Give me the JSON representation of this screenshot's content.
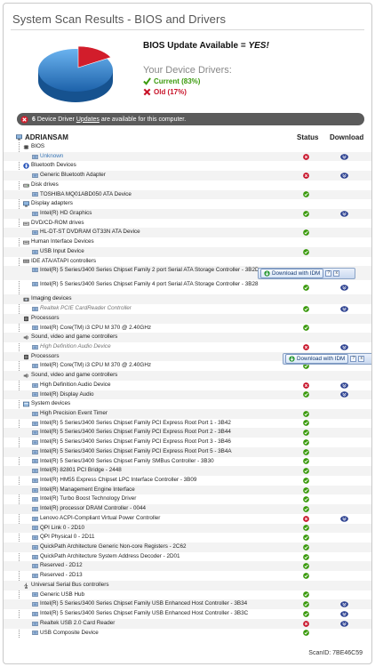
{
  "title": "System Scan Results - BIOS and Drivers",
  "summary": {
    "bios_prefix": "BIOS Update Available = ",
    "bios_value": "YES!",
    "drivers_title": "Your Device Drivers:",
    "current_label": "Current (83%)",
    "old_label": "Old (17%)",
    "current_fraction": 0.83,
    "old_fraction": 0.17
  },
  "banner": {
    "count": "6",
    "pre": "Device Driver",
    "link": "Updates",
    "post": "are available for this computer."
  },
  "table": {
    "root": "ADRIANSAM",
    "status_header": "Status",
    "download_header": "Download"
  },
  "rows": [
    {
      "kind": "cat",
      "text": "BIOS",
      "icon": "chip-icon"
    },
    {
      "kind": "dev",
      "text": "Unknown",
      "blue": true,
      "status": "old",
      "download": true
    },
    {
      "kind": "cat",
      "text": "Bluetooth Devices",
      "icon": "bluetooth-icon"
    },
    {
      "kind": "dev",
      "text": "Generic Bluetooth Adapter",
      "status": "old",
      "download": true
    },
    {
      "kind": "cat",
      "text": "Disk drives",
      "icon": "disk-icon"
    },
    {
      "kind": "dev",
      "text": "TOSHIBA MQ01ABD050 ATA Device",
      "status": "current"
    },
    {
      "kind": "cat",
      "text": "Display adapters",
      "icon": "monitor-icon"
    },
    {
      "kind": "dev",
      "text": "Intel(R) HD Graphics",
      "status": "current",
      "download": true
    },
    {
      "kind": "cat",
      "text": "DVD/CD-ROM drives",
      "icon": "dvd-icon"
    },
    {
      "kind": "dev",
      "text": "HL-DT-ST DVDRAM GT33N ATA Device",
      "status": "current"
    },
    {
      "kind": "cat",
      "text": "Human Interface Devices",
      "icon": "keyboard-icon"
    },
    {
      "kind": "dev",
      "text": "USB Input Device",
      "status": "current"
    },
    {
      "kind": "cat",
      "text": "IDE ATA/ATAPI controllers",
      "icon": "controller-icon"
    },
    {
      "kind": "dev",
      "wrap": true,
      "text": "Intel(R) 5 Series/3400 Series Chipset Family 2 port Serial ATA Storage Controller - 3B2D",
      "status": "current",
      "download": true
    },
    {
      "kind": "dev",
      "wrap": true,
      "text": "Intel(R) 5 Series/3400 Series Chipset Family 4 port Serial ATA Storage Controller - 3B28",
      "status": "current",
      "download": true
    },
    {
      "kind": "cat",
      "text": "Imaging devices",
      "icon": "camera-icon"
    },
    {
      "kind": "dev",
      "text": "Realtek PCIE CardReader Controller",
      "ghost": true,
      "status": "current",
      "download": true
    },
    {
      "kind": "cat",
      "text": "Processors",
      "icon": "cpu-icon"
    },
    {
      "kind": "dev",
      "text": "Intel(R) Core(TM) i3 CPU M 370 @ 2.40GHz",
      "status": "current"
    },
    {
      "kind": "cat",
      "text": "Sound, video and game controllers",
      "icon": "speaker-icon"
    },
    {
      "kind": "dev",
      "text": "High Definition Audio Device",
      "ghost": true,
      "status": "old",
      "download": true
    },
    {
      "kind": "cat",
      "text": "Processors",
      "icon": "cpu-icon"
    },
    {
      "kind": "dev",
      "text": "Intel(R) Core(TM) i3 CPU M 370 @ 2.40GHz",
      "status": "current"
    },
    {
      "kind": "cat",
      "text": "Sound, video and game controllers",
      "icon": "speaker-icon"
    },
    {
      "kind": "dev",
      "text": "High Definition Audio Device",
      "status": "old",
      "download": true
    },
    {
      "kind": "dev",
      "text": "Intel(R) Display Audio",
      "status": "current",
      "download": true
    },
    {
      "kind": "cat",
      "text": "System devices",
      "icon": "system-icon"
    },
    {
      "kind": "dev",
      "text": "High Precision Event Timer",
      "status": "current"
    },
    {
      "kind": "dev",
      "text": "Intel(R) 5 Series/3400 Series Chipset Family PCI Express Root Port 1 - 3B42",
      "status": "current"
    },
    {
      "kind": "dev",
      "text": "Intel(R) 5 Series/3400 Series Chipset Family PCI Express Root Port 2 - 3B44",
      "status": "current"
    },
    {
      "kind": "dev",
      "text": "Intel(R) 5 Series/3400 Series Chipset Family PCI Express Root Port 3 - 3B46",
      "status": "current"
    },
    {
      "kind": "dev",
      "text": "Intel(R) 5 Series/3400 Series Chipset Family PCI Express Root Port 5 - 3B4A",
      "status": "current"
    },
    {
      "kind": "dev",
      "text": "Intel(R) 5 Series/3400 Series Chipset Family SMBus Controller - 3B30",
      "status": "current"
    },
    {
      "kind": "dev",
      "text": "Intel(R) 82801 PCI Bridge - 2448",
      "status": "current"
    },
    {
      "kind": "dev",
      "text": "Intel(R) HM55 Express Chipset LPC Interface Controller - 3B09",
      "status": "current"
    },
    {
      "kind": "dev",
      "text": "Intel(R) Management Engine Interface",
      "status": "current"
    },
    {
      "kind": "dev",
      "text": "Intel(R) Turbo Boost Technology Driver",
      "status": "current"
    },
    {
      "kind": "dev",
      "text": "Intel(R) processor DRAM Controller - 0044",
      "status": "current"
    },
    {
      "kind": "dev",
      "text": "Lenovo ACPI-Compliant Virtual Power Controller",
      "status": "old",
      "download": true
    },
    {
      "kind": "dev",
      "text": "QPI Link 0 - 2D10",
      "status": "current"
    },
    {
      "kind": "dev",
      "text": "QPI Physical 0 - 2D11",
      "status": "current"
    },
    {
      "kind": "dev",
      "text": "QuickPath Architecture Generic Non-core Registers - 2C62",
      "status": "current"
    },
    {
      "kind": "dev",
      "text": "QuickPath Architecture System Address Decoder - 2D01",
      "status": "current"
    },
    {
      "kind": "dev",
      "text": "Reserved - 2D12",
      "status": "current"
    },
    {
      "kind": "dev",
      "text": "Reserved - 2D13",
      "status": "current"
    },
    {
      "kind": "cat",
      "text": "Universal Serial Bus controllers",
      "icon": "usb-icon"
    },
    {
      "kind": "dev",
      "text": "Generic USB Hub",
      "status": "current"
    },
    {
      "kind": "dev",
      "text": "Intel(R) 5 Series/3400 Series Chipset Family USB Enhanced Host Controller - 3B34",
      "status": "current",
      "download": true
    },
    {
      "kind": "dev",
      "text": "Intel(R) 5 Series/3400 Series Chipset Family USB Enhanced Host Controller - 3B3C",
      "status": "current",
      "download": true
    },
    {
      "kind": "dev",
      "text": "Realtek USB 2.0 Card Reader",
      "status": "old",
      "download": true
    },
    {
      "kind": "dev",
      "text": "USB Composite Device",
      "status": "current"
    }
  ],
  "idm_popups": [
    {
      "label": "Download with IDM"
    },
    {
      "label": "Download with IDM"
    }
  ],
  "scan_id": "ScanID: 7BE46C59",
  "colors": {
    "current": "#3a9a0c",
    "old": "#c8142a",
    "download": "#2a3f8f",
    "banner": "#5b5b5b",
    "pie_blue": "#2f7ec9",
    "pie_red": "#d21d2b"
  }
}
